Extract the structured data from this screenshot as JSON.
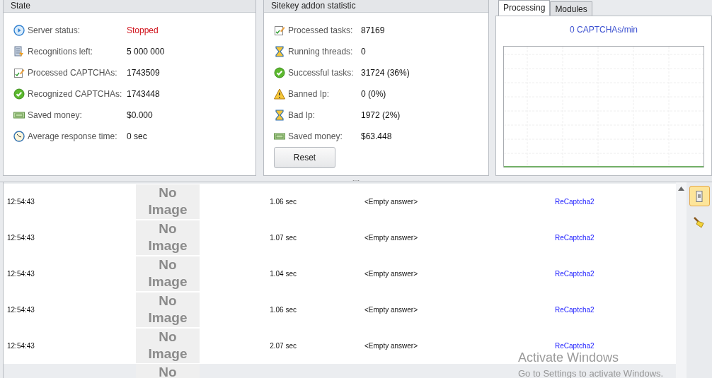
{
  "state_panel": {
    "title": "State",
    "rows": [
      {
        "kind": "play",
        "label": "Server status:",
        "value": "Stopped",
        "alert": true
      },
      {
        "kind": "doc",
        "label": "Recognitions  left:",
        "value": "5 000 000",
        "alert": false
      },
      {
        "kind": "edit",
        "label": "Processed CAPTCHAs:",
        "value": "1743509",
        "alert": false
      },
      {
        "kind": "check",
        "label": "Recognized CAPTCHAs:",
        "value": "1743448",
        "alert": false
      },
      {
        "kind": "money",
        "label": "Saved money:",
        "value": "$0.000",
        "alert": false
      },
      {
        "kind": "clock",
        "label": "Average response time:",
        "value": "0 sec",
        "alert": false
      }
    ]
  },
  "sitekey_panel": {
    "title": "Sitekey addon statistic",
    "rows": [
      {
        "kind": "edit",
        "label": "Processed tasks:",
        "value": "87169"
      },
      {
        "kind": "hourglass",
        "label": "Running threads:",
        "value": "0"
      },
      {
        "kind": "check",
        "label": "Successful tasks:",
        "value": "31724 (36%)"
      },
      {
        "kind": "warning",
        "label": "Banned Ip:",
        "value": "0 (0%)"
      },
      {
        "kind": "hourglass",
        "label": "Bad Ip:",
        "value": "1972 (2%)"
      },
      {
        "kind": "money",
        "label": "Saved money:",
        "value": "$63.448"
      }
    ],
    "button": "Reset"
  },
  "tabs": [
    {
      "label": "Processing",
      "selected": true
    },
    {
      "label": "Modules",
      "selected": false
    }
  ],
  "rate": "0 CAPTCHAs/min",
  "splitter": "....",
  "log": [
    {
      "time": "12:54:43",
      "thumb": "No Image",
      "duration": "1.06 sec",
      "answer": "<Empty answer>",
      "type": "ReCaptcha2",
      "selected": false
    },
    {
      "time": "12:54:43",
      "thumb": "No Image",
      "duration": "1.07 sec",
      "answer": "<Empty answer>",
      "type": "ReCaptcha2",
      "selected": false
    },
    {
      "time": "12:54:43",
      "thumb": "No Image",
      "duration": "1.04 sec",
      "answer": "<Empty answer>",
      "type": "ReCaptcha2",
      "selected": false
    },
    {
      "time": "12:54:43",
      "thumb": "No Image",
      "duration": "1.06 sec",
      "answer": "<Empty answer>",
      "type": "ReCaptcha2",
      "selected": false
    },
    {
      "time": "12:54:43",
      "thumb": "No Image",
      "duration": "2.07 sec",
      "answer": "<Empty answer>",
      "type": "ReCaptcha2",
      "selected": false
    },
    {
      "thumb": "No",
      "selected": true
    }
  ],
  "os_overlay": {
    "title": "Activate Windows",
    "subtitle": "Go to Settings to activate Windows."
  }
}
